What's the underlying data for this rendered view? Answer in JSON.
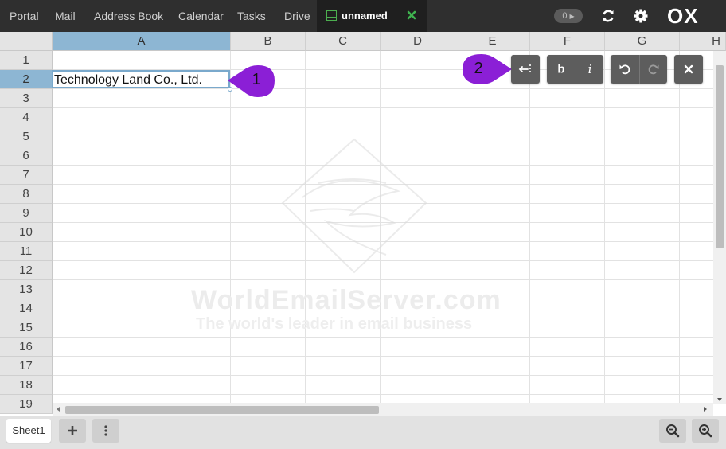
{
  "nav": {
    "items": [
      {
        "label": "Portal"
      },
      {
        "label": "Mail"
      },
      {
        "label": "Address Book"
      },
      {
        "label": "Calendar"
      },
      {
        "label": "Tasks"
      },
      {
        "label": "Drive"
      }
    ],
    "active_tab": {
      "label": "unnamed",
      "icon": "spreadsheet-icon",
      "close_icon": "close-icon",
      "close_color": "#3fb34f"
    },
    "badge": "0",
    "refresh_icon": "refresh-icon",
    "settings_icon": "gear-icon",
    "logo": "OX"
  },
  "sheet": {
    "columns": [
      "A",
      "B",
      "C",
      "D",
      "E",
      "F",
      "G",
      "H"
    ],
    "rows": [
      "1",
      "2",
      "3",
      "4",
      "5",
      "6",
      "7",
      "8",
      "9",
      "10",
      "11",
      "12",
      "13",
      "14",
      "15",
      "16",
      "17",
      "18",
      "19"
    ],
    "selected_column": "A",
    "selected_row": "2",
    "cell_value": "Technology Land Co., Ltd.",
    "selection_color": "#8db6d3"
  },
  "watermark": {
    "line1": "WorldEmailServer.com",
    "line2": "The world's leader in email business"
  },
  "toolbar": {
    "buttons": [
      "exit-edit-icon",
      "bold-icon",
      "italic-icon",
      "undo-icon",
      "redo-icon",
      "close-icon"
    ],
    "bold_label": "b",
    "italic_label": "i"
  },
  "callouts": [
    {
      "number": "1",
      "color": "#8b1fd6"
    },
    {
      "number": "2",
      "color": "#8b1fd6"
    }
  ],
  "bottom": {
    "sheet_tab": "Sheet1",
    "add_icon": "plus-icon",
    "more_icon": "vertical-dots-icon",
    "zoom_out_icon": "zoom-out-icon",
    "zoom_in_icon": "zoom-in-icon"
  }
}
